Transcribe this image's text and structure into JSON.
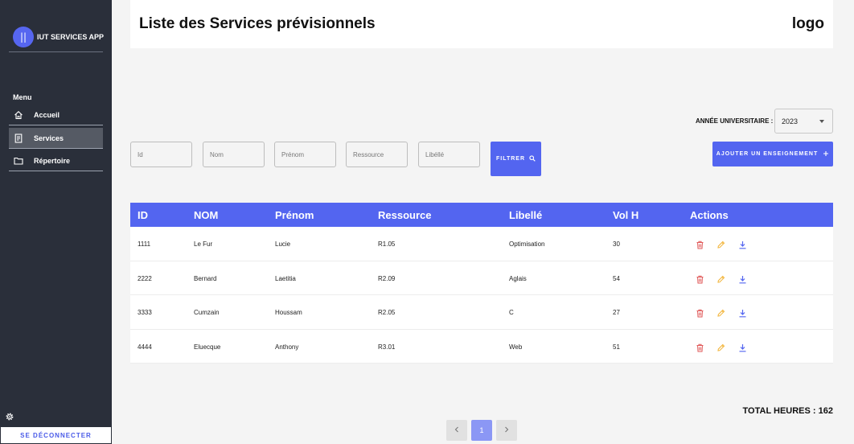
{
  "sidebar": {
    "brand_initials": "||",
    "brand_name": "IUT SERVICES APP",
    "menu_title": "Menu",
    "items": [
      {
        "label": "Accueil",
        "icon": "home-icon",
        "active": false
      },
      {
        "label": "Services",
        "icon": "document-icon",
        "active": true
      },
      {
        "label": "Répertoire",
        "icon": "folder-icon",
        "active": false
      }
    ],
    "settings_icon": "gear-icon",
    "logout_label": "SE DÉCONNECTER"
  },
  "header": {
    "title": "Liste des Services prévisionnels",
    "logo": "logo"
  },
  "year": {
    "label": "ANNÉE UNIVERSITAIRE :",
    "value": "2023"
  },
  "filters": {
    "id_placeholder": "Id",
    "nom_placeholder": "Nom",
    "prenom_placeholder": "Prénom",
    "ressource_placeholder": "Ressource",
    "libelle_placeholder": "Libéllé",
    "filter_button": "FILTRER",
    "add_button": "AJOUTER UN ENSEIGNEMENT"
  },
  "table": {
    "headers": {
      "id": "ID",
      "nom": "NOM",
      "prenom": "Prénom",
      "ressource": "Ressource",
      "libelle": "Libellé",
      "vol": "Vol H",
      "actions": "Actions"
    },
    "rows": [
      {
        "id": "1111",
        "nom": "Le Fur",
        "prenom": "Lucie",
        "ressource": "R1.05",
        "libelle": "Optimisation",
        "vol": "30"
      },
      {
        "id": "2222",
        "nom": "Bernard",
        "prenom": "Laetitia",
        "ressource": "R2.09",
        "libelle": "Aglais",
        "vol": "54"
      },
      {
        "id": "3333",
        "nom": "Cumzain",
        "prenom": "Houssam",
        "ressource": "R2.05",
        "libelle": "C",
        "vol": "27"
      },
      {
        "id": "4444",
        "nom": "Eluecque",
        "prenom": "Anthony",
        "ressource": "R3.01",
        "libelle": "Web",
        "vol": "51"
      }
    ],
    "action_icons": [
      "trash-icon",
      "pencil-icon",
      "download-icon"
    ]
  },
  "footer": {
    "total": "TOTAL HEURES : 162",
    "current_page": "1"
  },
  "colors": {
    "sidebar_bg": "#2a2f3a",
    "accent": "#5365f0",
    "delete": "#e05a5a",
    "edit": "#f2b233",
    "download": "#5365f0"
  }
}
